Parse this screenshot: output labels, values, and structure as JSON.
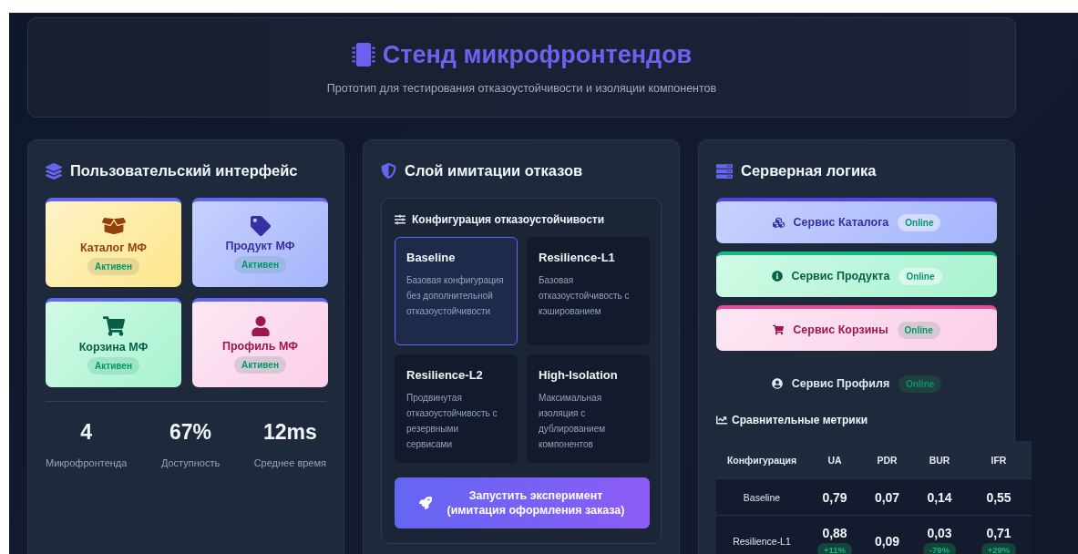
{
  "header": {
    "title": "Стенд микрофронтендов",
    "subtitle": "Прототип для тестирования отказоустойчивости и изоляции компонентов"
  },
  "ui_panel": {
    "title": "Пользовательский интерфейс",
    "microfrontends": [
      {
        "kind": "catalog",
        "name": "Каталог МФ",
        "status": "Активен"
      },
      {
        "kind": "product",
        "name": "Продукт МФ",
        "status": "Активен"
      },
      {
        "kind": "cart",
        "name": "Корзина МФ",
        "status": "Активен"
      },
      {
        "kind": "profile",
        "name": "Профиль МФ",
        "status": "Активен"
      }
    ],
    "stats": [
      {
        "value": "4",
        "label": "Микрофронтенда"
      },
      {
        "value": "67%",
        "label": "Доступность"
      },
      {
        "value": "12ms",
        "label": "Среднее время"
      }
    ]
  },
  "fault_panel": {
    "title": "Слой имитации отказов",
    "config_title": "Конфигурация отказоустойчивости",
    "configs": [
      {
        "name": "Baseline",
        "description": "Базовая конфигурация без дополнительной отказоустойчивости",
        "selected": true
      },
      {
        "name": "Resilience-L1",
        "description": "Базовая отказоустойчивость с кэшированием",
        "selected": false
      },
      {
        "name": "Resilience-L2",
        "description": "Продвинутая отказоустойчивость с резервными сервисами",
        "selected": false
      },
      {
        "name": "High-Isolation",
        "description": "Максимальная изоляция с дублированием компонентов",
        "selected": false
      }
    ],
    "run_button": [
      "Запустить эксперимент",
      "(имитация оформления заказа)"
    ]
  },
  "server_panel": {
    "title": "Серверная логика",
    "services": [
      {
        "kind": "catalog",
        "name": "Сервис Каталога",
        "status": "Online"
      },
      {
        "kind": "product",
        "name": "Сервис Продукта",
        "status": "Online"
      },
      {
        "kind": "cart",
        "name": "Сервис Корзины",
        "status": "Online"
      },
      {
        "kind": "profile",
        "name": "Сервис Профиля",
        "status": "Online"
      }
    ],
    "metrics": {
      "title": "Сравнительные метрики",
      "columns": [
        "Конфигурация",
        "UA",
        "PDR",
        "BUR",
        "IFR"
      ],
      "rows": [
        {
          "cells": [
            {
              "value": "Baseline"
            },
            {
              "value": "0,79"
            },
            {
              "value": "0,07"
            },
            {
              "value": "0,14"
            },
            {
              "value": "0,55"
            }
          ]
        },
        {
          "cells": [
            {
              "value": "Resilience-L1"
            },
            {
              "value": "0,88",
              "delta": "+11%"
            },
            {
              "value": "0,09"
            },
            {
              "value": "0,03",
              "delta": "-79%"
            },
            {
              "value": "0,71",
              "delta": "+29%"
            }
          ]
        }
      ]
    }
  }
}
